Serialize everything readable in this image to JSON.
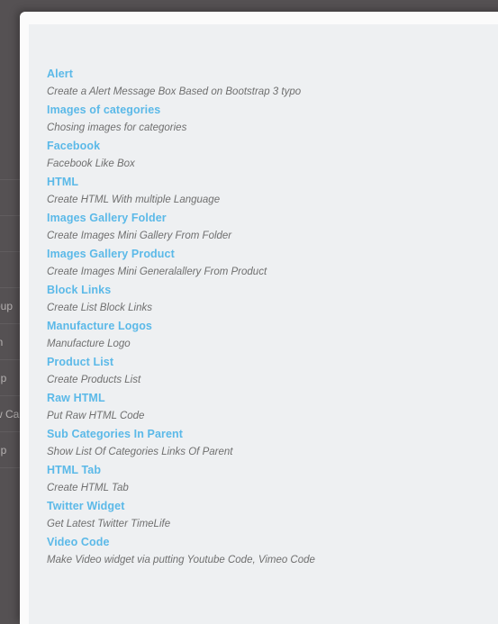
{
  "overlay": {
    "color": "#555153"
  },
  "background_page": {
    "rows": [
      {
        "text": ""
      },
      {
        "text": ""
      },
      {
        "text": ""
      },
      {
        "text": ""
      },
      {
        "text": "oup"
      },
      {
        "text": "in  "
      },
      {
        "text": "up"
      },
      {
        "text": "w Ca"
      },
      {
        "text": "up"
      }
    ]
  },
  "modal": {
    "background_color": "#fbfbfb",
    "panel_color": "#eef0f2",
    "link_color": "#5bb9e8",
    "description_color": "#6f6f6f",
    "widgets": [
      {
        "title": "Alert",
        "description": "Create a Alert Message Box Based on Bootstrap 3 typo"
      },
      {
        "title": "Images of categories",
        "description": "Chosing images for categories"
      },
      {
        "title": "Facebook",
        "description": "Facebook Like Box"
      },
      {
        "title": "HTML",
        "description": "Create HTML With multiple Language"
      },
      {
        "title": "Images Gallery Folder",
        "description": "Create Images Mini Gallery From Folder"
      },
      {
        "title": "Images Gallery Product",
        "description": "Create Images Mini Generalallery From Product"
      },
      {
        "title": "Block Links",
        "description": "Create List Block Links"
      },
      {
        "title": "Manufacture Logos",
        "description": "Manufacture Logo"
      },
      {
        "title": "Product List",
        "description": "Create Products List"
      },
      {
        "title": "Raw HTML",
        "description": "Put Raw HTML Code"
      },
      {
        "title": "Sub Categories In Parent",
        "description": "Show List Of Categories Links Of Parent"
      },
      {
        "title": "HTML Tab",
        "description": "Create HTML Tab"
      },
      {
        "title": "Twitter Widget",
        "description": "Get Latest Twitter TimeLife"
      },
      {
        "title": "Video Code",
        "description": "Make Video widget via putting Youtube Code, Vimeo Code"
      }
    ]
  }
}
